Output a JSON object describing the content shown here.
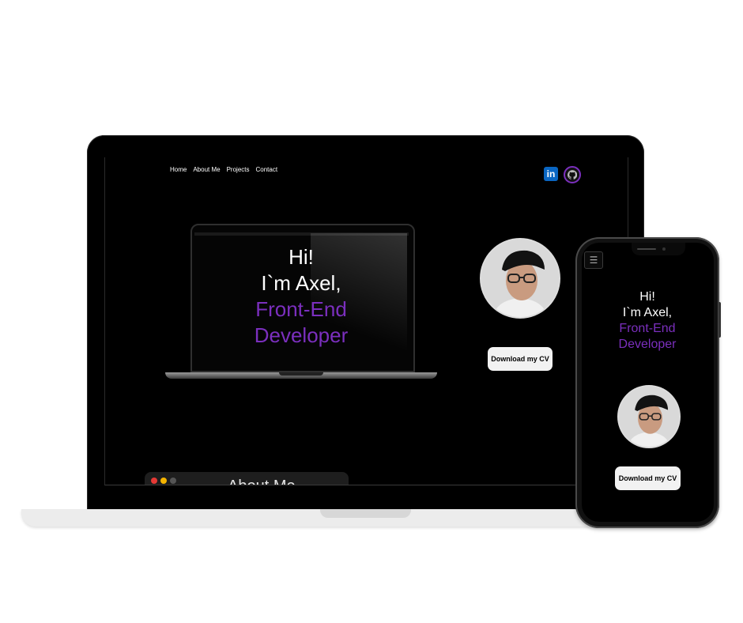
{
  "nav": {
    "items": [
      {
        "label": "Home"
      },
      {
        "label": "About Me"
      },
      {
        "label": "Projects"
      },
      {
        "label": "Contact"
      }
    ]
  },
  "social": {
    "linkedin_icon": "linkedin-icon",
    "linkedin_text": "in",
    "github_icon": "github-icon"
  },
  "hero": {
    "greeting": "Hi!",
    "name_line": "I`m Axel,",
    "role_line1": "Front-End",
    "role_line2": "Developer",
    "cv_button": "Download my CV"
  },
  "about": {
    "title": "About Me"
  },
  "colors": {
    "background": "#000000",
    "accent": "#7b2fbe",
    "button_bg": "#f2f2f2",
    "linkedin": "#0a66c2"
  }
}
